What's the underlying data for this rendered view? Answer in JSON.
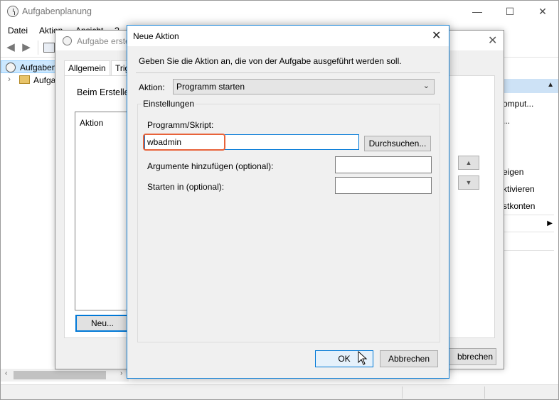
{
  "main_window": {
    "title": "Aufgabenplanung",
    "controls": {
      "minimize": "—",
      "maximize": "☐",
      "close": "✕"
    },
    "menu": [
      "Datei",
      "Aktion",
      "Ansicht",
      "?"
    ],
    "tree": {
      "root_label": "Aufgaben",
      "child_label": "Aufga"
    },
    "actions_pane": {
      "items": [
        "omput...",
        "...",
        "eigen",
        "ktivieren",
        "stkonten"
      ]
    }
  },
  "create_task_dialog": {
    "title": "Aufgabe erste",
    "tabs": [
      "Allgemein",
      "Trig"
    ],
    "description": "Beim Erstelle",
    "list_header": "Aktion",
    "new_button": "Neu...",
    "cancel_button": "bbrechen"
  },
  "new_action_dialog": {
    "title": "Neue Aktion",
    "instruction": "Geben Sie die Aktion an, die von der Aufgabe ausgeführt werden soll.",
    "action_label": "Aktion:",
    "action_value": "Programm starten",
    "settings_group": "Einstellungen",
    "program_label": "Programm/Skript:",
    "program_value": "wbadmin",
    "browse_button": "Durchsuchen...",
    "arguments_label": "Argumente hinzufügen (optional):",
    "arguments_value": "",
    "start_in_label": "Starten in (optional):",
    "start_in_value": "",
    "ok_button": "OK",
    "cancel_button": "Abbrechen"
  },
  "colors": {
    "accent": "#0078d7",
    "highlight": "#e8633a",
    "selection": "#cce8ff"
  }
}
